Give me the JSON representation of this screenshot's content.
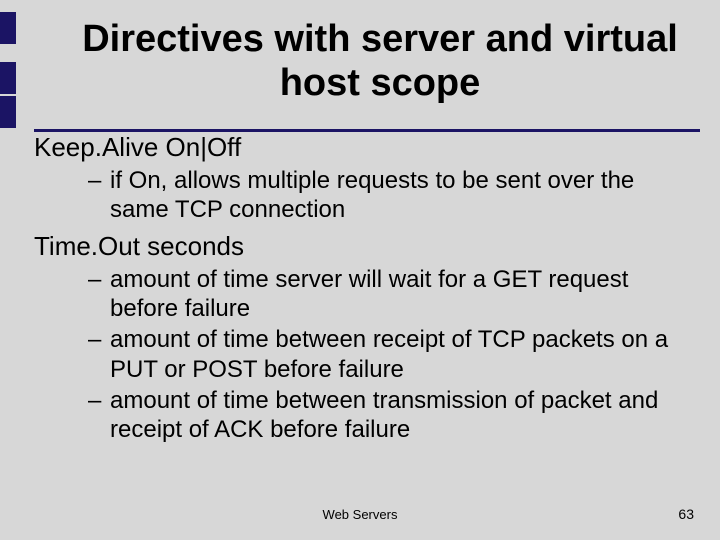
{
  "title": "Directives with server and virtual host scope",
  "directive1": {
    "heading": "Keep.Alive On|Off",
    "items": [
      "if On, allows multiple requests to be sent over the same TCP connection"
    ]
  },
  "directive2": {
    "heading": "Time.Out  seconds",
    "items": [
      "amount of time server will wait for a GET request before failure",
      "amount of time between receipt of TCP packets on a PUT or POST before failure",
      "amount of time between transmission of packet and receipt of ACK before failure"
    ]
  },
  "footer": {
    "label": "Web Servers",
    "page": "63"
  },
  "marks": [
    12,
    62,
    96
  ]
}
